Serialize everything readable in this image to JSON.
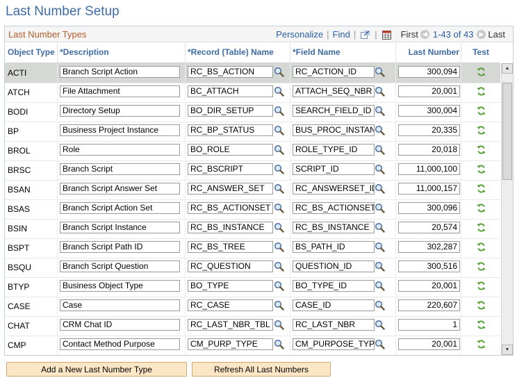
{
  "page_title": "Last Number Setup",
  "grid": {
    "title": "Last Number Types",
    "personalize_label": "Personalize",
    "find_label": "Find",
    "first_label": "First",
    "range_label": "1-43 of 43",
    "last_label": "Last"
  },
  "columns": {
    "object_type": "Object Type",
    "description": "*Description",
    "record": "*Record (Table) Name",
    "field": "*Field Name",
    "last_number": "Last Number",
    "test": "Test"
  },
  "rows": [
    {
      "type": "ACTI",
      "description": "Branch Script Action",
      "record": "RC_BS_ACTION",
      "field": "RC_ACTION_ID",
      "last_number": "300,094"
    },
    {
      "type": "ATCH",
      "description": "File Attachment",
      "record": "BC_ATTACH",
      "field": "ATTACH_SEQ_NBR",
      "last_number": "20,001"
    },
    {
      "type": "BODI",
      "description": "Directory Setup",
      "record": "BO_DIR_SETUP",
      "field": "SEARCH_FIELD_ID",
      "last_number": "300,004"
    },
    {
      "type": "BP",
      "description": "Business Project Instance",
      "record": "RC_BP_STATUS",
      "field": "BUS_PROC_INSTAN",
      "last_number": "20,335"
    },
    {
      "type": "BROL",
      "description": "Role",
      "record": "BO_ROLE",
      "field": "ROLE_TYPE_ID",
      "last_number": "20,018"
    },
    {
      "type": "BRSC",
      "description": "Branch Script",
      "record": "RC_BSCRIPT",
      "field": "SCRIPT_ID",
      "last_number": "11,000,100"
    },
    {
      "type": "BSAN",
      "description": "Branch Script Answer Set",
      "record": "RC_ANSWER_SET",
      "field": "RC_ANSWERSET_ID",
      "last_number": "11,000,157"
    },
    {
      "type": "BSAS",
      "description": "Branch Script Action Set",
      "record": "RC_BS_ACTIONSET",
      "field": "RC_BS_ACTIONSET",
      "last_number": "300,096"
    },
    {
      "type": "BSIN",
      "description": "Branch Script Instance",
      "record": "RC_BS_INSTANCE",
      "field": "RC_BS_INSTANCE",
      "last_number": "20,574"
    },
    {
      "type": "BSPT",
      "description": "Branch Script Path ID",
      "record": "RC_BS_TREE",
      "field": "BS_PATH_ID",
      "last_number": "302,287"
    },
    {
      "type": "BSQU",
      "description": "Branch Script Question",
      "record": "RC_QUESTION",
      "field": "QUESTION_ID",
      "last_number": "300,516"
    },
    {
      "type": "BTYP",
      "description": "Business Object Type",
      "record": "BO_TYPE",
      "field": "BO_TYPE_ID",
      "last_number": "20,001"
    },
    {
      "type": "CASE",
      "description": "Case",
      "record": "RC_CASE",
      "field": "CASE_ID",
      "last_number": "220,607"
    },
    {
      "type": "CHAT",
      "description": "CRM Chat ID",
      "record": "RC_LAST_NBR_TBL",
      "field": "RC_LAST_NBR",
      "last_number": "1"
    },
    {
      "type": "CMP",
      "description": "Contact Method Purpose",
      "record": "CM_PURP_TYPE",
      "field": "CM_PURPOSE_TYPE",
      "last_number": "20,001"
    }
  ],
  "buttons": {
    "add": "Add a New Last Number Type",
    "refresh_all": "Refresh All Last Numbers"
  },
  "icons": {
    "lookup": "magnifier-icon",
    "refresh": "refresh-icon",
    "zoom": "new-window-icon",
    "download": "spreadsheet-icon",
    "first": "arrow-left-icon",
    "last": "arrow-right-icon"
  },
  "colors": {
    "title": "#3e6ba5",
    "grid_title": "#b45c29",
    "link": "#2a5ea4",
    "selected_row": "#d6d8d6",
    "button_bg": "#fbe7c5",
    "refresh_icon": "#4a9a2a"
  }
}
